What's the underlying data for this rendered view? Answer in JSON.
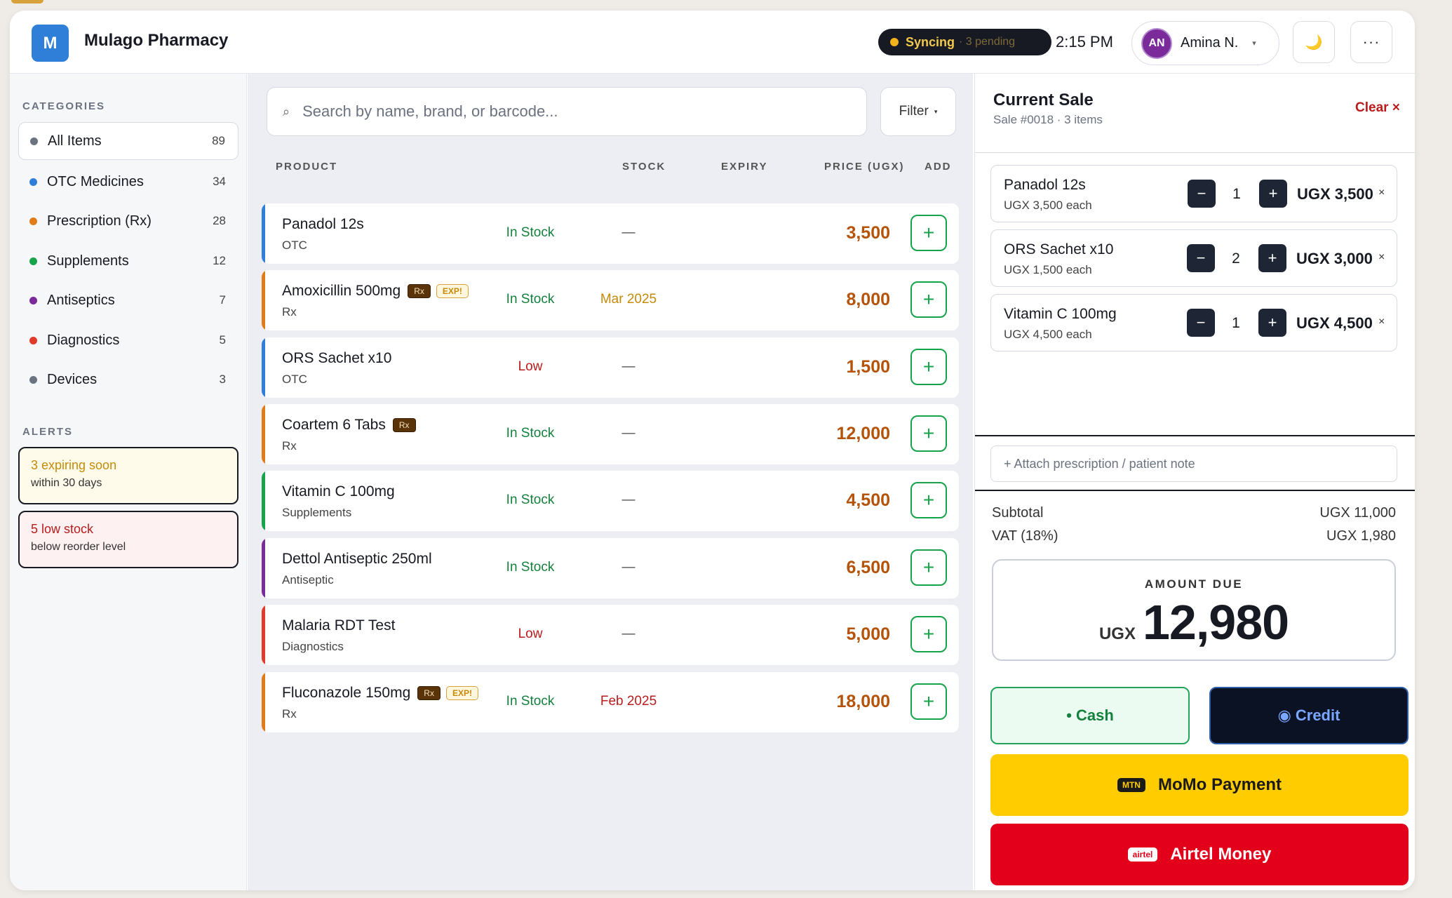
{
  "colors": {
    "brand": "#2f7fd8",
    "ink": "#171a22",
    "green": "#16a34a",
    "red": "#b91c1c",
    "amber": "#b45309",
    "mtn_yellow": "#ffcc00",
    "airtel_red": "#e2001a"
  },
  "header": {
    "logo_letter": "M",
    "title": "Mulago Pharmacy",
    "sync_label": "Syncing",
    "sync_pending": "· 3 pending",
    "time": "2:15 PM",
    "user_initials": "AN",
    "user_name": "Amina N.",
    "user_chevron": "▾",
    "theme_icon": "🌙",
    "more_icon": "···"
  },
  "sidebar": {
    "categories_label": "CATEGORIES",
    "categories": [
      {
        "label": "All Items",
        "count": "89",
        "color": "#6b7280"
      },
      {
        "label": "OTC Medicines",
        "count": "34",
        "color": "#2f7fd8"
      },
      {
        "label": "Prescription (Rx)",
        "count": "28",
        "color": "#e07b1a"
      },
      {
        "label": "Supplements",
        "count": "12",
        "color": "#16a34a"
      },
      {
        "label": "Antiseptics",
        "count": "7",
        "color": "#7b2a9a"
      },
      {
        "label": "Diagnostics",
        "count": "5",
        "color": "#e03a2a"
      },
      {
        "label": "Devices",
        "count": "3",
        "color": "#6b7280"
      }
    ],
    "alerts_label": "ALERTS",
    "alerts": [
      {
        "title": "3 expiring soon",
        "detail": "within 30 days"
      },
      {
        "title": "5 low stock",
        "detail": "below reorder level"
      }
    ]
  },
  "catalog": {
    "search_icon": "⌕",
    "search_placeholder": "Search by name, brand, or barcode...",
    "filter_label": "Filter",
    "filter_chevron": "▾",
    "columns": {
      "product": "PRODUCT",
      "stock": "STOCK",
      "expiry": "EXPIRY",
      "price": "PRICE (UGX)",
      "add": "ADD"
    },
    "add_icon": "+",
    "products": [
      {
        "name": "Panadol 12s",
        "category": "OTC",
        "rx": "",
        "exp": "",
        "stock": "In Stock",
        "expiry": "—",
        "price": "3,500",
        "bar": "#2f7fd8"
      },
      {
        "name": "Amoxicillin 500mg",
        "category": "Rx",
        "rx": "Rx",
        "exp": "EXP!",
        "stock": "In Stock",
        "expiry": "Mar 2025",
        "price": "8,000",
        "bar": "#e07b1a"
      },
      {
        "name": "ORS Sachet x10",
        "category": "OTC",
        "rx": "",
        "exp": "",
        "stock": "Low",
        "expiry": "—",
        "price": "1,500",
        "bar": "#2f7fd8"
      },
      {
        "name": "Coartem 6 Tabs",
        "category": "Rx",
        "rx": "Rx",
        "exp": "",
        "stock": "In Stock",
        "expiry": "—",
        "price": "12,000",
        "bar": "#e07b1a"
      },
      {
        "name": "Vitamin C 100mg",
        "category": "Supplements",
        "rx": "",
        "exp": "",
        "stock": "In Stock",
        "expiry": "—",
        "price": "4,500",
        "bar": "#16a34a"
      },
      {
        "name": "Dettol Antiseptic 250ml",
        "category": "Antiseptic",
        "rx": "",
        "exp": "",
        "stock": "In Stock",
        "expiry": "—",
        "price": "6,500",
        "bar": "#7b2a9a"
      },
      {
        "name": "Malaria RDT Test",
        "category": "Diagnostics",
        "rx": "",
        "exp": "",
        "stock": "Low",
        "expiry": "—",
        "price": "5,000",
        "bar": "#e03a2a"
      },
      {
        "name": "Fluconazole 150mg",
        "category": "Rx",
        "rx": "Rx",
        "exp": "EXP!",
        "stock": "In Stock",
        "expiry": "Feb 2025",
        "price": "18,000",
        "bar": "#e07b1a"
      }
    ]
  },
  "sale": {
    "title": "Current Sale",
    "subtitle": "Sale #0018 · 3 items",
    "clear_label": "Clear ×",
    "minus_icon": "−",
    "plus_icon": "+",
    "remove_icon": "×",
    "items": [
      {
        "name": "Panadol 12s",
        "each": "UGX 3,500 each",
        "qty": "1",
        "total": "UGX 3,500"
      },
      {
        "name": "ORS Sachet x10",
        "each": "UGX 1,500 each",
        "qty": "2",
        "total": "UGX 3,000"
      },
      {
        "name": "Vitamin C 100mg",
        "each": "UGX 4,500 each",
        "qty": "1",
        "total": "UGX 4,500"
      }
    ],
    "note_placeholder": "+ Attach prescription / patient note",
    "subtotal_label": "Subtotal",
    "subtotal_value": "UGX 11,000",
    "vat_label": "VAT (18%)",
    "vat_value": "UGX 1,980",
    "due_label": "AMOUNT DUE",
    "due_currency": "UGX",
    "due_value": "12,980",
    "pay_cash": "• Cash",
    "pay_credit": "◉ Credit",
    "momo_tag": "MTN",
    "momo_label": "MoMo Payment",
    "airtel_tag": "airtel",
    "airtel_label": "Airtel Money"
  }
}
